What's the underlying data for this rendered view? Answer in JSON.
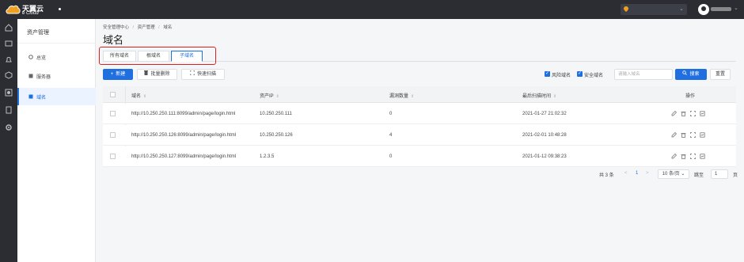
{
  "brand": {
    "name": "天翼云",
    "sub": "e Cloud"
  },
  "top": {
    "user_chevron": "⌄",
    "region_chevron": "⌄"
  },
  "nav": {
    "title": "资产管理",
    "items": [
      {
        "label": "总览",
        "active": false
      },
      {
        "label": "服务器",
        "active": false
      },
      {
        "label": "域名",
        "active": true
      }
    ]
  },
  "breadcrumb": {
    "items": [
      "安全管理中心",
      "资产管理",
      "域名"
    ],
    "sep": "/"
  },
  "page_title": "域名",
  "tabs": [
    {
      "label": "所有域名",
      "active": false
    },
    {
      "label": "根域名",
      "active": false
    },
    {
      "label": "子域名",
      "active": true
    }
  ],
  "toolbar": {
    "new_label": "新建",
    "new_icon": "+",
    "batch_delete_label": "批量删除",
    "quick_scan_label": "快速扫描",
    "risk_domain_label": "风险域名",
    "safe_domain_label": "安全域名",
    "search_placeholder": "请输入域名",
    "search_label": "搜索",
    "reset_label": "重置"
  },
  "table": {
    "columns": [
      "域名",
      "资产IP",
      "漏洞数量",
      "最后扫描时间",
      "操作"
    ],
    "sort_glyph": "⇕",
    "rows": [
      {
        "domain": "http://10.250.250.111:8099/admin/page/login.html",
        "ip": "10.250.250.111",
        "vulns": "0",
        "last_scan": "2021-01-27 21:02:32"
      },
      {
        "domain": "http://10.250.250.126:8099/admin/page/login.html",
        "ip": "10.250.250.126",
        "vulns": "4",
        "last_scan": "2021-02-01 10:48:28"
      },
      {
        "domain": "http://10.250.250.127:8099/admin/page/login.html",
        "ip": "1.2.3.5",
        "vulns": "0",
        "last_scan": "2021-01-12 09:38:23"
      }
    ]
  },
  "pagination": {
    "total": "共 3 条",
    "prev": "<",
    "current_page": "1",
    "next": ">",
    "page_size": "10 条/页",
    "page_size_chevron": "⌄",
    "jump_label": "跳至",
    "jump_value": "1",
    "page_unit": "页"
  },
  "colors": {
    "accent": "#1f6fe0",
    "topbar": "#2b2d33",
    "highlight": "#e02020"
  }
}
